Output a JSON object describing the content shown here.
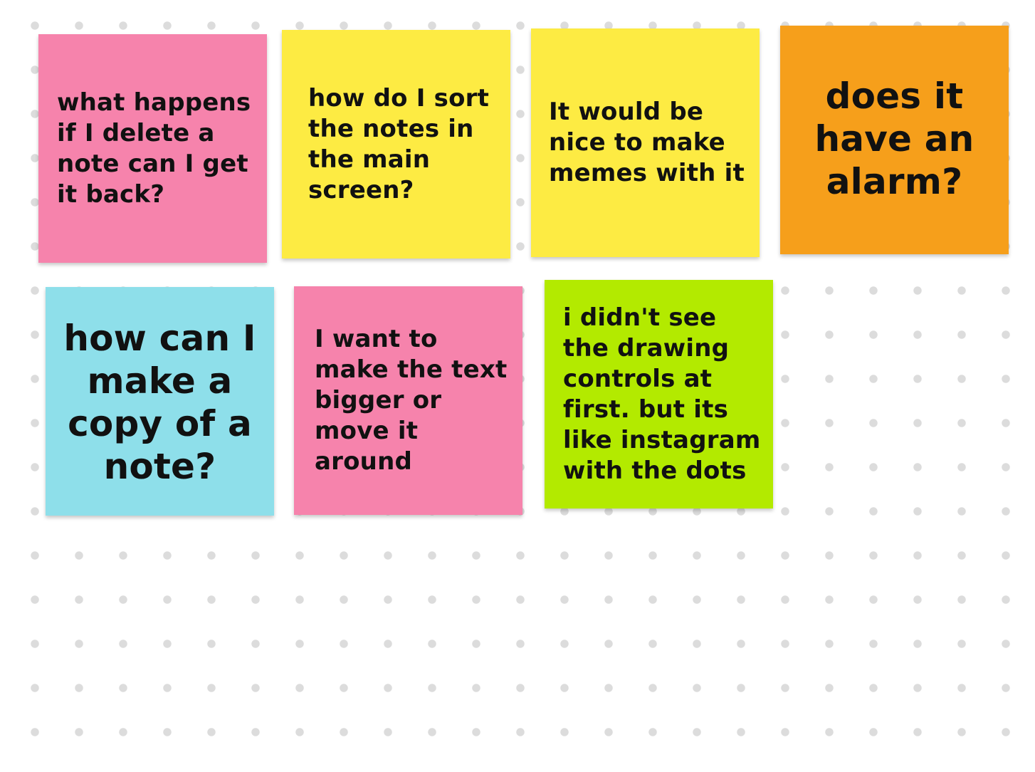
{
  "colors": {
    "pink": "#f683ac",
    "yellow": "#fdeb43",
    "orange": "#f69f1b",
    "cyan": "#8edfea",
    "lime": "#b3ea00",
    "background": "#ffffff",
    "grid_dot": "#dcdcdc"
  },
  "notes": [
    {
      "text": "what happens\nif I delete a\nnote can I get\nit back?",
      "color": "#f683ac"
    },
    {
      "text": "how do I sort\nthe notes in\nthe main\nscreen?",
      "color": "#fdeb43"
    },
    {
      "text": "It would be\nnice to make\nmemes with it",
      "color": "#fdeb43"
    },
    {
      "text": "does it\nhave an\nalarm?",
      "color": "#f69f1b"
    },
    {
      "text": "how can I\nmake a\ncopy of a\nnote?",
      "color": "#8edfea"
    },
    {
      "text": "I want to\nmake the text\nbigger or\nmove it\naround",
      "color": "#f683ac"
    },
    {
      "text": "i didn't see\nthe drawing\ncontrols at\nfirst. but its\nlike instagram\nwith the dots",
      "color": "#b3ea00"
    }
  ]
}
